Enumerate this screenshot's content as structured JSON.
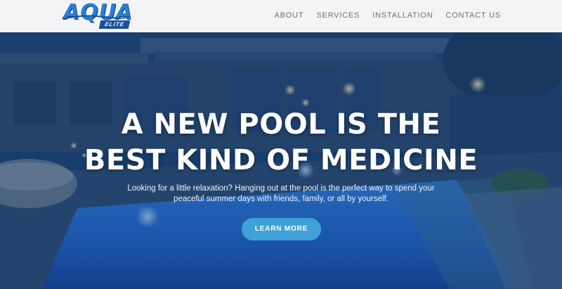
{
  "logo": {
    "primary": "AQUA",
    "secondary": "ELITE"
  },
  "nav": {
    "items": [
      {
        "label": "ABOUT"
      },
      {
        "label": "SERVICES"
      },
      {
        "label": "INSTALLATION"
      },
      {
        "label": "CONTACT US"
      }
    ]
  },
  "hero": {
    "headline_line1": "A NEW POOL IS THE",
    "headline_line2": "BEST KIND OF MEDICINE",
    "subtext": "Looking for a little relaxation? Hanging out at the pool is the perfect way to spend your peaceful summer days with friends, family, or all by yourself.",
    "cta_label": "LEARN MORE"
  },
  "colors": {
    "accent": "#3ea2d8",
    "brand_blue": "#2b7fd4",
    "nav_text": "#6f6f72",
    "header_bg": "#f4f4f6"
  }
}
